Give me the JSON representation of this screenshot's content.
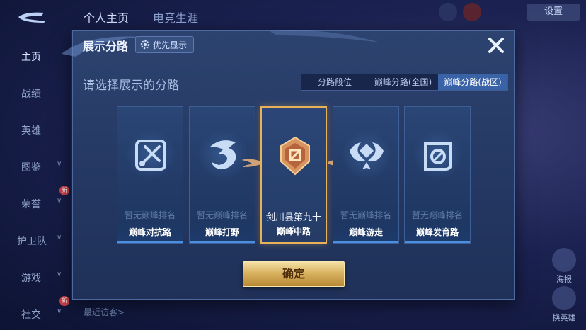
{
  "background": {
    "top_tabs": [
      "个人主页",
      "电竞生涯"
    ],
    "sidebar": [
      {
        "label": "主页",
        "active": true
      },
      {
        "label": "战绩"
      },
      {
        "label": "英雄"
      },
      {
        "label": "图鉴",
        "has_chevron": true
      },
      {
        "label": "荣誉",
        "has_chevron": true,
        "badge": "新"
      },
      {
        "label": "护卫队",
        "has_chevron": true
      },
      {
        "label": "游戏",
        "has_chevron": true
      },
      {
        "label": "社交",
        "has_chevron": true,
        "badge": "新"
      }
    ],
    "settings_label": "设置",
    "recent_visitors_label": "最近访客>",
    "right_buttons": [
      "海报",
      "换英雄"
    ]
  },
  "modal": {
    "title": "展示分路",
    "priority_label": "优先显示",
    "subtitle": "请选择展示的分路",
    "tabs": [
      {
        "label": "分路段位",
        "active": false
      },
      {
        "label": "巅峰分路(全国)",
        "active": false
      },
      {
        "label": "巅峰分路(战区)",
        "active": true
      }
    ],
    "cards": [
      {
        "name": "巅峰对抗路",
        "rank_text": "暂无巅峰排名",
        "icon": "sword-shield-icon",
        "selected": false
      },
      {
        "name": "巅峰打野",
        "rank_text": "暂无巅峰排名",
        "icon": "dragon-icon",
        "selected": false
      },
      {
        "name": "巅峰中路",
        "rank_text": "剑川县第九十六",
        "icon": "gold-crest-icon",
        "selected": true
      },
      {
        "name": "巅峰游走",
        "rank_text": "暂无巅峰排名",
        "icon": "wings-icon",
        "selected": false
      },
      {
        "name": "巅峰发育路",
        "rank_text": "暂无巅峰排名",
        "icon": "crosshair-icon",
        "selected": false
      }
    ],
    "confirm_label": "确定"
  },
  "colors": {
    "modal_bg": "#2d436f",
    "accent_blue": "#3a62a6",
    "selected_gold": "#e7b25a",
    "confirm_gold": "#d9b361"
  }
}
